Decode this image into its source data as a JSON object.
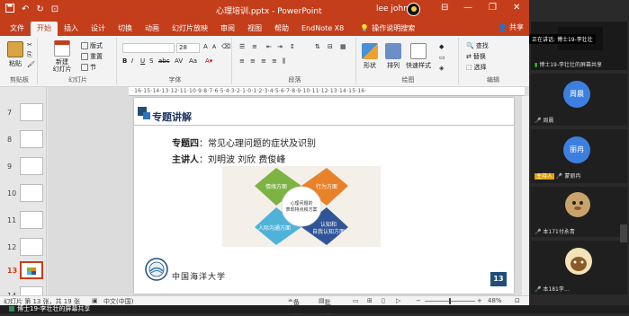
{
  "colors": {
    "accent": "#c43e1c",
    "slide_blue": "#1f4e79",
    "green": "#7cb342",
    "orange": "#e8822a",
    "teal": "#4fb3d9",
    "navy": "#2f5597"
  },
  "titlebar": {
    "title": "心理培训.pptx  -  PowerPoint",
    "user": "lee john",
    "minimize": "—",
    "restore": "❐",
    "close": "✕"
  },
  "qat": {
    "save_icon": "save-icon",
    "undo": "↶",
    "redo": "↻",
    "present": "⊡"
  },
  "tabs": [
    "文件",
    "开始",
    "插入",
    "设计",
    "切换",
    "动画",
    "幻灯片放映",
    "审阅",
    "视图",
    "帮助",
    "EndNote X8"
  ],
  "tellme": "操作说明搜索",
  "share": "共享",
  "ribbon": {
    "clipboard": {
      "paste": "粘贴",
      "label": "剪贴板"
    },
    "slides": {
      "new_slide": "新建\n幻灯片",
      "layout": "版式",
      "reset": "重置",
      "section": "节",
      "label": "幻灯片"
    },
    "font": {
      "font_name": "",
      "font_size": "28",
      "label": "字体",
      "bold": "B",
      "italic": "I",
      "underline": "U",
      "shadow": "S",
      "strike": "abc",
      "spacing": "AV",
      "case": "Aa",
      "grow": "A",
      "shrink": "A"
    },
    "paragraph": {
      "label": "段落"
    },
    "drawing": {
      "shapes": "形状",
      "arrange": "排列",
      "quick_styles": "快速样式",
      "label": "绘图"
    },
    "editing": {
      "find": "查找",
      "replace": "替换",
      "select": "选择",
      "label": "编辑"
    }
  },
  "thumbnails": [
    {
      "num": "7",
      "active": false
    },
    {
      "num": "8",
      "active": false
    },
    {
      "num": "9",
      "active": false
    },
    {
      "num": "10",
      "active": false
    },
    {
      "num": "11",
      "active": false
    },
    {
      "num": "12",
      "active": false
    },
    {
      "num": "13",
      "active": true
    },
    {
      "num": "14",
      "active": false
    }
  ],
  "ruler": "·16·15·14·13·12·11·10·9·8·7·6·5·4·3·2·1·0·1·2·3·4·5·6·7·8·9·10·11·12·13·14·15·16·",
  "slide": {
    "title": "专题讲解",
    "topic_label": "专题四",
    "topic_text": "：常见心理问题的症状及识别",
    "speaker_label": "主讲人",
    "speaker_text": "：刘明波  刘欣  费俊峰",
    "diagram": {
      "center": [
        "心理问题的",
        "表现特点和方案"
      ],
      "top_left": "情绪方面",
      "top_right": "行为方面",
      "bottom_left": "人际沟通方面",
      "bottom_right": [
        "认知和",
        "自我认知方面"
      ]
    },
    "school": "中国海洋大学",
    "page_number": "13"
  },
  "status": {
    "slide_info": "幻灯片 第 13 张，共 19 张",
    "language": "中文(中国)",
    "notes": "备注",
    "comments": "批注",
    "zoom": "48%",
    "zoom_fraction": 0.48
  },
  "sharebar": "博士19-李壮壮的屏幕共享",
  "meeting": {
    "speaking_prefix": "正在讲话:",
    "speaking_name": "博士19-李壮壮",
    "top_tile_name": "博士19-李壮壮的屏幕共享",
    "tile2_avatar": "周晨",
    "tile2_name": "周晨",
    "tile3_avatar": "丽冉",
    "tile3_name": "蒙丽冉",
    "host_tag": "主持人",
    "tile4_name": "本171付永青",
    "tile5_name": "本181李…"
  }
}
